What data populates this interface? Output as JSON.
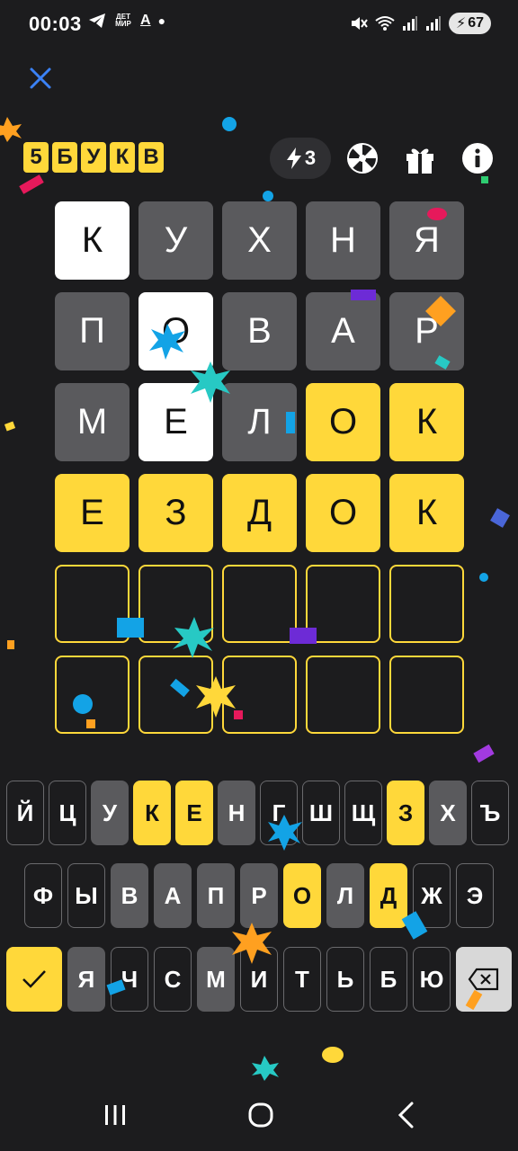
{
  "status_bar": {
    "time": "00:03",
    "app_badge": "ДЕТ МИР",
    "a_label": "A",
    "battery": "67"
  },
  "header": {
    "logo_letters": [
      "5",
      "Б",
      "У",
      "К",
      "В"
    ],
    "hints_count": "3"
  },
  "grid": {
    "rows": [
      [
        {
          "l": "К",
          "s": "white"
        },
        {
          "l": "У",
          "s": "gray"
        },
        {
          "l": "Х",
          "s": "gray"
        },
        {
          "l": "Н",
          "s": "gray"
        },
        {
          "l": "Я",
          "s": "gray"
        }
      ],
      [
        {
          "l": "П",
          "s": "gray"
        },
        {
          "l": "О",
          "s": "white"
        },
        {
          "l": "В",
          "s": "gray"
        },
        {
          "l": "А",
          "s": "gray"
        },
        {
          "l": "Р",
          "s": "gray"
        }
      ],
      [
        {
          "l": "М",
          "s": "gray"
        },
        {
          "l": "Е",
          "s": "white"
        },
        {
          "l": "Л",
          "s": "gray"
        },
        {
          "l": "О",
          "s": "yellow"
        },
        {
          "l": "К",
          "s": "yellow"
        }
      ],
      [
        {
          "l": "Е",
          "s": "yellow"
        },
        {
          "l": "З",
          "s": "yellow"
        },
        {
          "l": "Д",
          "s": "yellow"
        },
        {
          "l": "О",
          "s": "yellow"
        },
        {
          "l": "К",
          "s": "yellow"
        }
      ],
      [
        {
          "l": "",
          "s": "empty"
        },
        {
          "l": "",
          "s": "empty"
        },
        {
          "l": "",
          "s": "empty"
        },
        {
          "l": "",
          "s": "empty"
        },
        {
          "l": "",
          "s": "empty"
        }
      ],
      [
        {
          "l": "",
          "s": "empty"
        },
        {
          "l": "",
          "s": "empty"
        },
        {
          "l": "",
          "s": "empty"
        },
        {
          "l": "",
          "s": "empty"
        },
        {
          "l": "",
          "s": "empty"
        }
      ]
    ]
  },
  "keyboard": {
    "row1": [
      {
        "k": "Й",
        "s": "default"
      },
      {
        "k": "Ц",
        "s": "default"
      },
      {
        "k": "У",
        "s": "gray"
      },
      {
        "k": "К",
        "s": "yellow"
      },
      {
        "k": "Е",
        "s": "yellow"
      },
      {
        "k": "Н",
        "s": "gray"
      },
      {
        "k": "Г",
        "s": "default"
      },
      {
        "k": "Ш",
        "s": "default"
      },
      {
        "k": "Щ",
        "s": "default"
      },
      {
        "k": "З",
        "s": "yellow"
      },
      {
        "k": "Х",
        "s": "gray"
      },
      {
        "k": "Ъ",
        "s": "default"
      }
    ],
    "row2": [
      {
        "k": "Ф",
        "s": "default"
      },
      {
        "k": "Ы",
        "s": "default"
      },
      {
        "k": "В",
        "s": "gray"
      },
      {
        "k": "А",
        "s": "gray"
      },
      {
        "k": "П",
        "s": "gray"
      },
      {
        "k": "Р",
        "s": "gray"
      },
      {
        "k": "О",
        "s": "yellow"
      },
      {
        "k": "Л",
        "s": "gray"
      },
      {
        "k": "Д",
        "s": "yellow"
      },
      {
        "k": "Ж",
        "s": "default"
      },
      {
        "k": "Э",
        "s": "default"
      }
    ],
    "row3": [
      {
        "k": "Я",
        "s": "gray"
      },
      {
        "k": "Ч",
        "s": "default"
      },
      {
        "k": "С",
        "s": "default"
      },
      {
        "k": "М",
        "s": "gray"
      },
      {
        "k": "И",
        "s": "default"
      },
      {
        "k": "Т",
        "s": "default"
      },
      {
        "k": "Ь",
        "s": "default"
      },
      {
        "k": "Б",
        "s": "default"
      },
      {
        "k": "Ю",
        "s": "default"
      }
    ],
    "enter_icon": "checkmark-icon",
    "backspace_icon": "backspace-icon"
  },
  "colors": {
    "background": "#1c1c1e",
    "correct": "#ffd83a",
    "absent": "#5a5a5d",
    "present": "#ffffff",
    "accent_close": "#3b82f6"
  }
}
